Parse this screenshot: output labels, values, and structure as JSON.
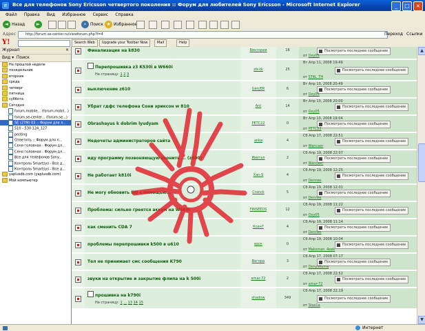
{
  "window": {
    "title": "Все для телефонов Sony Ericsson четвертого поколения :: Форум для любителей Sony Ericsson - Microsoft Internet Explorer"
  },
  "menu": [
    "Файл",
    "Правка",
    "Вид",
    "Избранное",
    "Сервис",
    "Справка"
  ],
  "toolbar": {
    "back": "Назад",
    "search": "Поиск",
    "favorites": "Избранное"
  },
  "address": {
    "label": "Адрес",
    "url": "http://forum.se-center.ru/viewforum.php?f=4",
    "go": "Переход",
    "links": "Ссылки"
  },
  "yahoo": {
    "logo": "Y!",
    "buttons": [
      "Search Web",
      "Upgrade your Toolbar Now",
      "Mail",
      "Help"
    ]
  },
  "sidebar": {
    "title": "Журнал",
    "view_label": "Вид",
    "search_label": "Поиск",
    "items": [
      {
        "label": "На прошлой неделе",
        "type": "folder"
      },
      {
        "label": "понедельник",
        "type": "folder"
      },
      {
        "label": "вторник",
        "type": "folder"
      },
      {
        "label": "среда",
        "type": "folder"
      },
      {
        "label": "четверг",
        "type": "folder"
      },
      {
        "label": "пятница",
        "type": "folder"
      },
      {
        "label": "суббота",
        "type": "folder"
      },
      {
        "label": "Сегодня",
        "type": "folder"
      },
      {
        "label": "forum.mobile... (forum.mobil...)",
        "type": "page"
      },
      {
        "label": "forum.se-center... (forum.se...)",
        "type": "page"
      },
      {
        "label": "SE (27M) 03 :: Форум для л...",
        "type": "page",
        "selected": true
      },
      {
        "label": "510 - 530 124_127",
        "type": "page"
      },
      {
        "label": "posting",
        "type": "page"
      },
      {
        "label": "Ответить :: Форум для л...",
        "type": "page"
      },
      {
        "label": "Сеня головная - Форум дл...",
        "type": "page"
      },
      {
        "label": "Сеня головная - Форум дл...",
        "type": "page"
      },
      {
        "label": "Все для телефонов Sony...",
        "type": "page"
      },
      {
        "label": "Контроль Smartsys - Все д...",
        "type": "page"
      },
      {
        "label": "Контроль Smartsys - Все д...",
        "type": "page"
      },
      {
        "label": "yaplusdb.com (yaplusdb.com)",
        "type": "folder"
      },
      {
        "label": "Мой компьютер",
        "type": "folder"
      }
    ]
  },
  "topics": [
    {
      "title": "Финализация на k830",
      "author": "Виктория",
      "replies": "16",
      "date": "Вт Апр 11, 2008 22:03",
      "by": "Oxy05",
      "pages": null
    },
    {
      "title": "Перепрошивка z3 K530i в W660i",
      "author": "zik-tk",
      "replies": "25",
      "date": "Вт Апр 11, 2008 19:49",
      "by": "ST4L_TH",
      "pages": [
        "1",
        "2",
        "3"
      ],
      "pages_prefix": "На страницу:"
    },
    {
      "title": "выключение z610",
      "author": "Gen/ER",
      "replies": "6",
      "date": "Вт Апр 10, 2008 20:49",
      "by": "Oxy05",
      "pages": null
    },
    {
      "title": "Убрат гдфс телефона Сони эриксон w 810",
      "author": "Ant",
      "replies": "14",
      "date": "Вт Апр 10, 2008 20:00",
      "by": "Oxy05",
      "pages": null
    },
    {
      "title": "Obrashayus k dobrim lyudyam",
      "author": "РЕТС22",
      "replies": "0",
      "date": "Вт Апр 10, 2008 19:04",
      "by": "РЕТС22",
      "pages": null
    },
    {
      "title": "Недочеты администраторов сайта",
      "author": "anka",
      "replies": "4",
      "date": "Сб Апр 17, 2008 22:51",
      "by": "Wancaer",
      "pages": null
    },
    {
      "title": "иду программу позвоняющую звонить ... (z800)",
      "author": "Ивитал",
      "replies": "2",
      "date": "Сб Апр 19, 2008 22:07",
      "by": "Wancaer",
      "pages": null
    },
    {
      "title": "Не работает k810i",
      "author": "Xan-S",
      "replies": "4",
      "date": "Сб Апр 19, 2008 12:25",
      "by": "Dennes",
      "pages": null
    },
    {
      "title": "Не могу обновить ПО с помощью...",
      "author": "Cranck",
      "replies": "5",
      "date": "Сб Апр 19, 2008 12:01",
      "by": "Dennes",
      "pages": null
    },
    {
      "title": "Проблема: сильно греется аккум на W580i",
      "author": "FINSEEDS",
      "replies": "12",
      "date": "Сб Апр 19, 2008 11:22",
      "by": "Oxy05",
      "pages": null
    },
    {
      "title": "как сменить CDA 7",
      "author": "Ксен7",
      "replies": "4",
      "date": "Сб Апр 19, 2008 11:14",
      "by": "Dennes",
      "pages": null
    },
    {
      "title": "проблемы перепрошивки k500 в u610",
      "author": "васк",
      "replies": "0",
      "date": "Сб Апр 19, 2008 10:04",
      "by": "Maksman_4eek",
      "pages": null
    },
    {
      "title": "Тел не принимает смс сообщения K790",
      "author": "Вегора",
      "replies": "3",
      "date": "Сб Апр 17, 2008 07:17",
      "by": "DenysKuma",
      "pages": null
    },
    {
      "title": "звуки на открытие и закрытие флипа на k 500i",
      "author": "amar-72",
      "replies": "2",
      "date": "Сб Апр 17, 2008 22:52",
      "by": "amar-72",
      "pages": null
    },
    {
      "title": "прошивка на k790i",
      "author": "shadow",
      "replies": "349",
      "date": "Сб Апр 17, 2008 22:19",
      "by": "Stas1a",
      "pages": [
        "1",
        "...",
        "13",
        "14",
        "15"
      ],
      "pages_prefix": "На страницу:"
    }
  ],
  "last_post_button": "Посмотреть последнее сообщение",
  "by_prefix": "от",
  "status": {
    "zone": "Интернет"
  },
  "colors": {
    "title_blue": "#0846b3",
    "topic_green": "#0b5d0b",
    "scribble_red": "#e0202a"
  }
}
